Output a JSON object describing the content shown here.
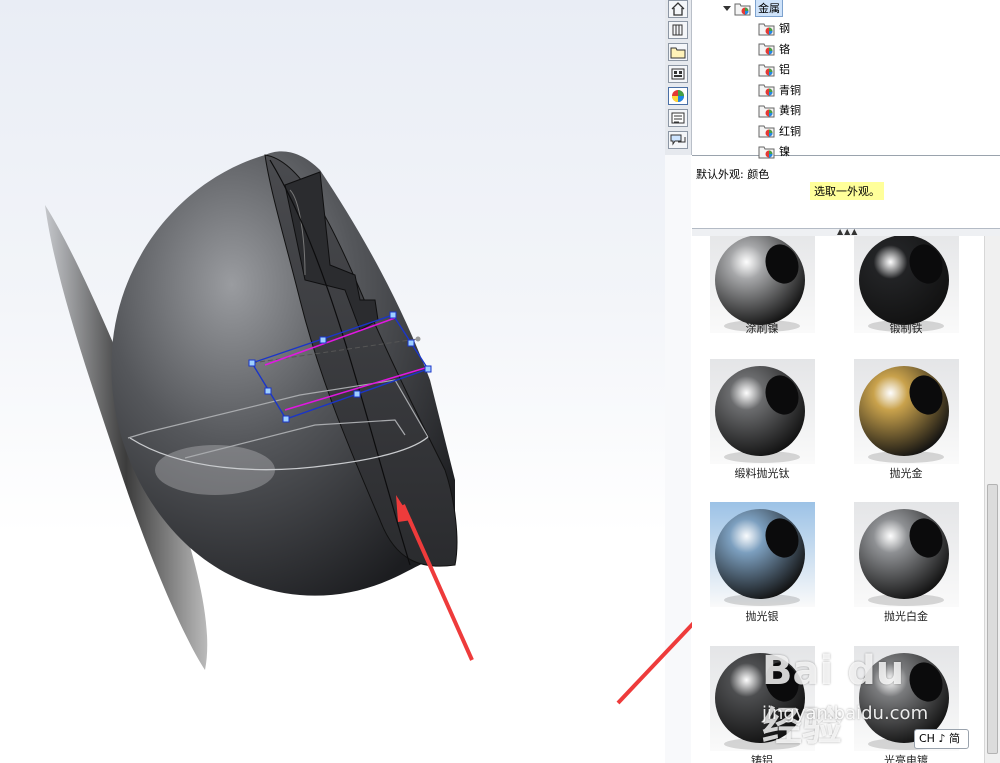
{
  "tree": {
    "parent": "金属",
    "items": [
      "钢",
      "铬",
      "铝",
      "青铜",
      "黄铜",
      "红铜",
      "镍"
    ]
  },
  "info": {
    "default_appearance": "默认外观: 颜色",
    "hint": "选取一外观。"
  },
  "gallery": {
    "swatches": [
      {
        "label": "涂刷镍",
        "color": "#a6a7a9"
      },
      {
        "label": "锻制铁",
        "color": "#222325"
      },
      {
        "label": "缎料抛光钛",
        "color": "#6b6c6e"
      },
      {
        "label": "抛光金",
        "color": "#c9a24c"
      },
      {
        "label": "抛光银",
        "color": "#7c9fbf"
      },
      {
        "label": "抛光白金",
        "color": "#8e9093"
      },
      {
        "label": "铸铝",
        "color": "#4d4e50"
      },
      {
        "label": "光亮电镀",
        "color": "#7a7b7d"
      }
    ]
  },
  "tabs": [
    "home-icon",
    "parts-icon",
    "folder-icon",
    "view-palette-icon",
    "appearances-icon",
    "custom-properties-icon",
    "forum-icon"
  ],
  "watermark": {
    "logo": "Bai du 经验",
    "url": "jingyan.baidu.com"
  },
  "ime": {
    "label": "CH ♪ 简"
  }
}
